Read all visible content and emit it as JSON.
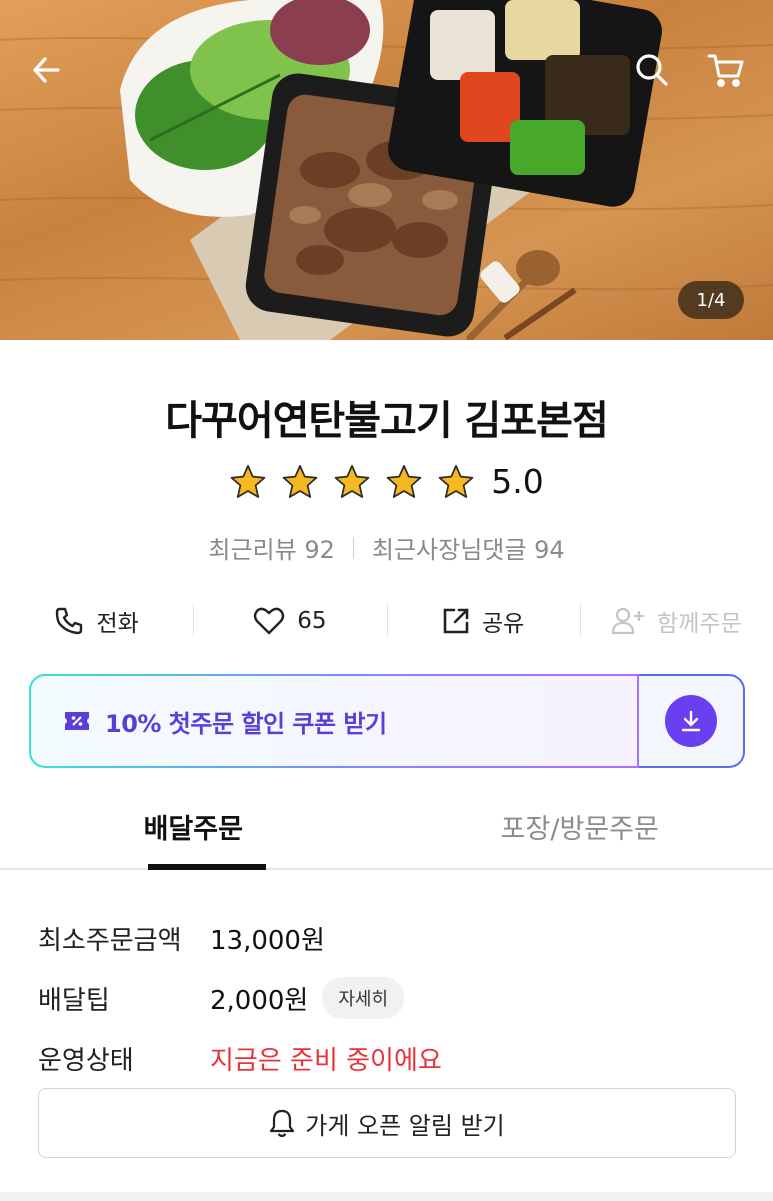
{
  "hero": {
    "pager": "1/4",
    "icons": [
      "back-arrow-icon",
      "search-icon",
      "cart-icon"
    ]
  },
  "store": {
    "name": "다꾸어연탄불고기 김포본점",
    "rating_value": "5.0",
    "stars": 5,
    "recent_reviews": "최근리뷰 92",
    "recent_owner_replies": "최근사장님댓글 94"
  },
  "actions": {
    "call": "전화",
    "likes": "65",
    "share": "공유",
    "group_order": "함께주문"
  },
  "coupon": {
    "label": "10% 첫주문 할인 쿠폰 받기",
    "color_start": "#36e2d6",
    "color_end": "#b26cff"
  },
  "tabs": {
    "delivery": "배달주문",
    "pickup": "포장/방문주문"
  },
  "info": {
    "min_order_label": "최소주문금액",
    "min_order_value": "13,000원",
    "delivery_tip_label": "배달팁",
    "delivery_tip_value": "2,000원",
    "detail_badge": "자세히",
    "status_label": "운영상태",
    "status_value": "지금은 준비 중이에요",
    "status_color": "#e8333a"
  },
  "notify_button": "가게 오픈 알림 받기"
}
